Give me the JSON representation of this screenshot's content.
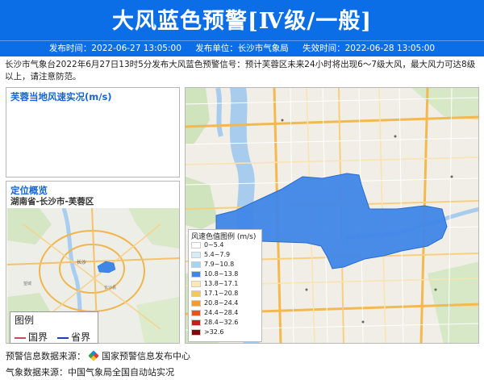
{
  "header": {
    "title": "大风蓝色预警[Ⅳ级/一般]"
  },
  "meta": {
    "publish_time": "发布时间：2022-06-27 13:05:00",
    "publisher": "发布单位：长沙市气象局",
    "expire_time": "失效时间：2022-06-28 13:05:00"
  },
  "summary": "长沙市气象台2022年6月27日13时5分发布大风蓝色预警信号：预计芙蓉区未来24小时将出现6～7级大风，最大风力可达8级以上，请注意防范。",
  "wind_panel": {
    "title": "芙蓉当地风速实况(m/s)"
  },
  "location_panel": {
    "title": "定位概览",
    "region": "湖南省-长沙市-芙蓉区"
  },
  "map_legend": {
    "title": "图例",
    "items": [
      {
        "label": "国界",
        "color": "#c0505a"
      },
      {
        "label": "省界",
        "color": "#1e3fb0"
      }
    ]
  },
  "wind_legend": {
    "title": "风速色值图例 (m/s)",
    "items": [
      {
        "label": "0~5.4",
        "color": "#ffffff"
      },
      {
        "label": "5.4~7.9",
        "color": "#d6ecfa"
      },
      {
        "label": "7.9~10.8",
        "color": "#a8d4f3"
      },
      {
        "label": "10.8~13.8",
        "color": "#3f86e8"
      },
      {
        "label": "13.8~17.1",
        "color": "#fbe9b4"
      },
      {
        "label": "17.1~20.8",
        "color": "#f6c85a"
      },
      {
        "label": "20.8~24.4",
        "color": "#f49a2f"
      },
      {
        "label": "24.4~28.4",
        "color": "#e5561d"
      },
      {
        "label": "28.4~32.6",
        "color": "#c0211a"
      },
      {
        "label": ">32.6",
        "color": "#7a0b0b"
      }
    ]
  },
  "main_map": {
    "area_color": "#3f86e8"
  },
  "footer": {
    "warning_source_label": "预警信息数据来源：",
    "warning_source": "国家预警信息发布中心",
    "weather_source_label": "气象数据来源：",
    "weather_source": "中国气象局全国自动站实况"
  }
}
